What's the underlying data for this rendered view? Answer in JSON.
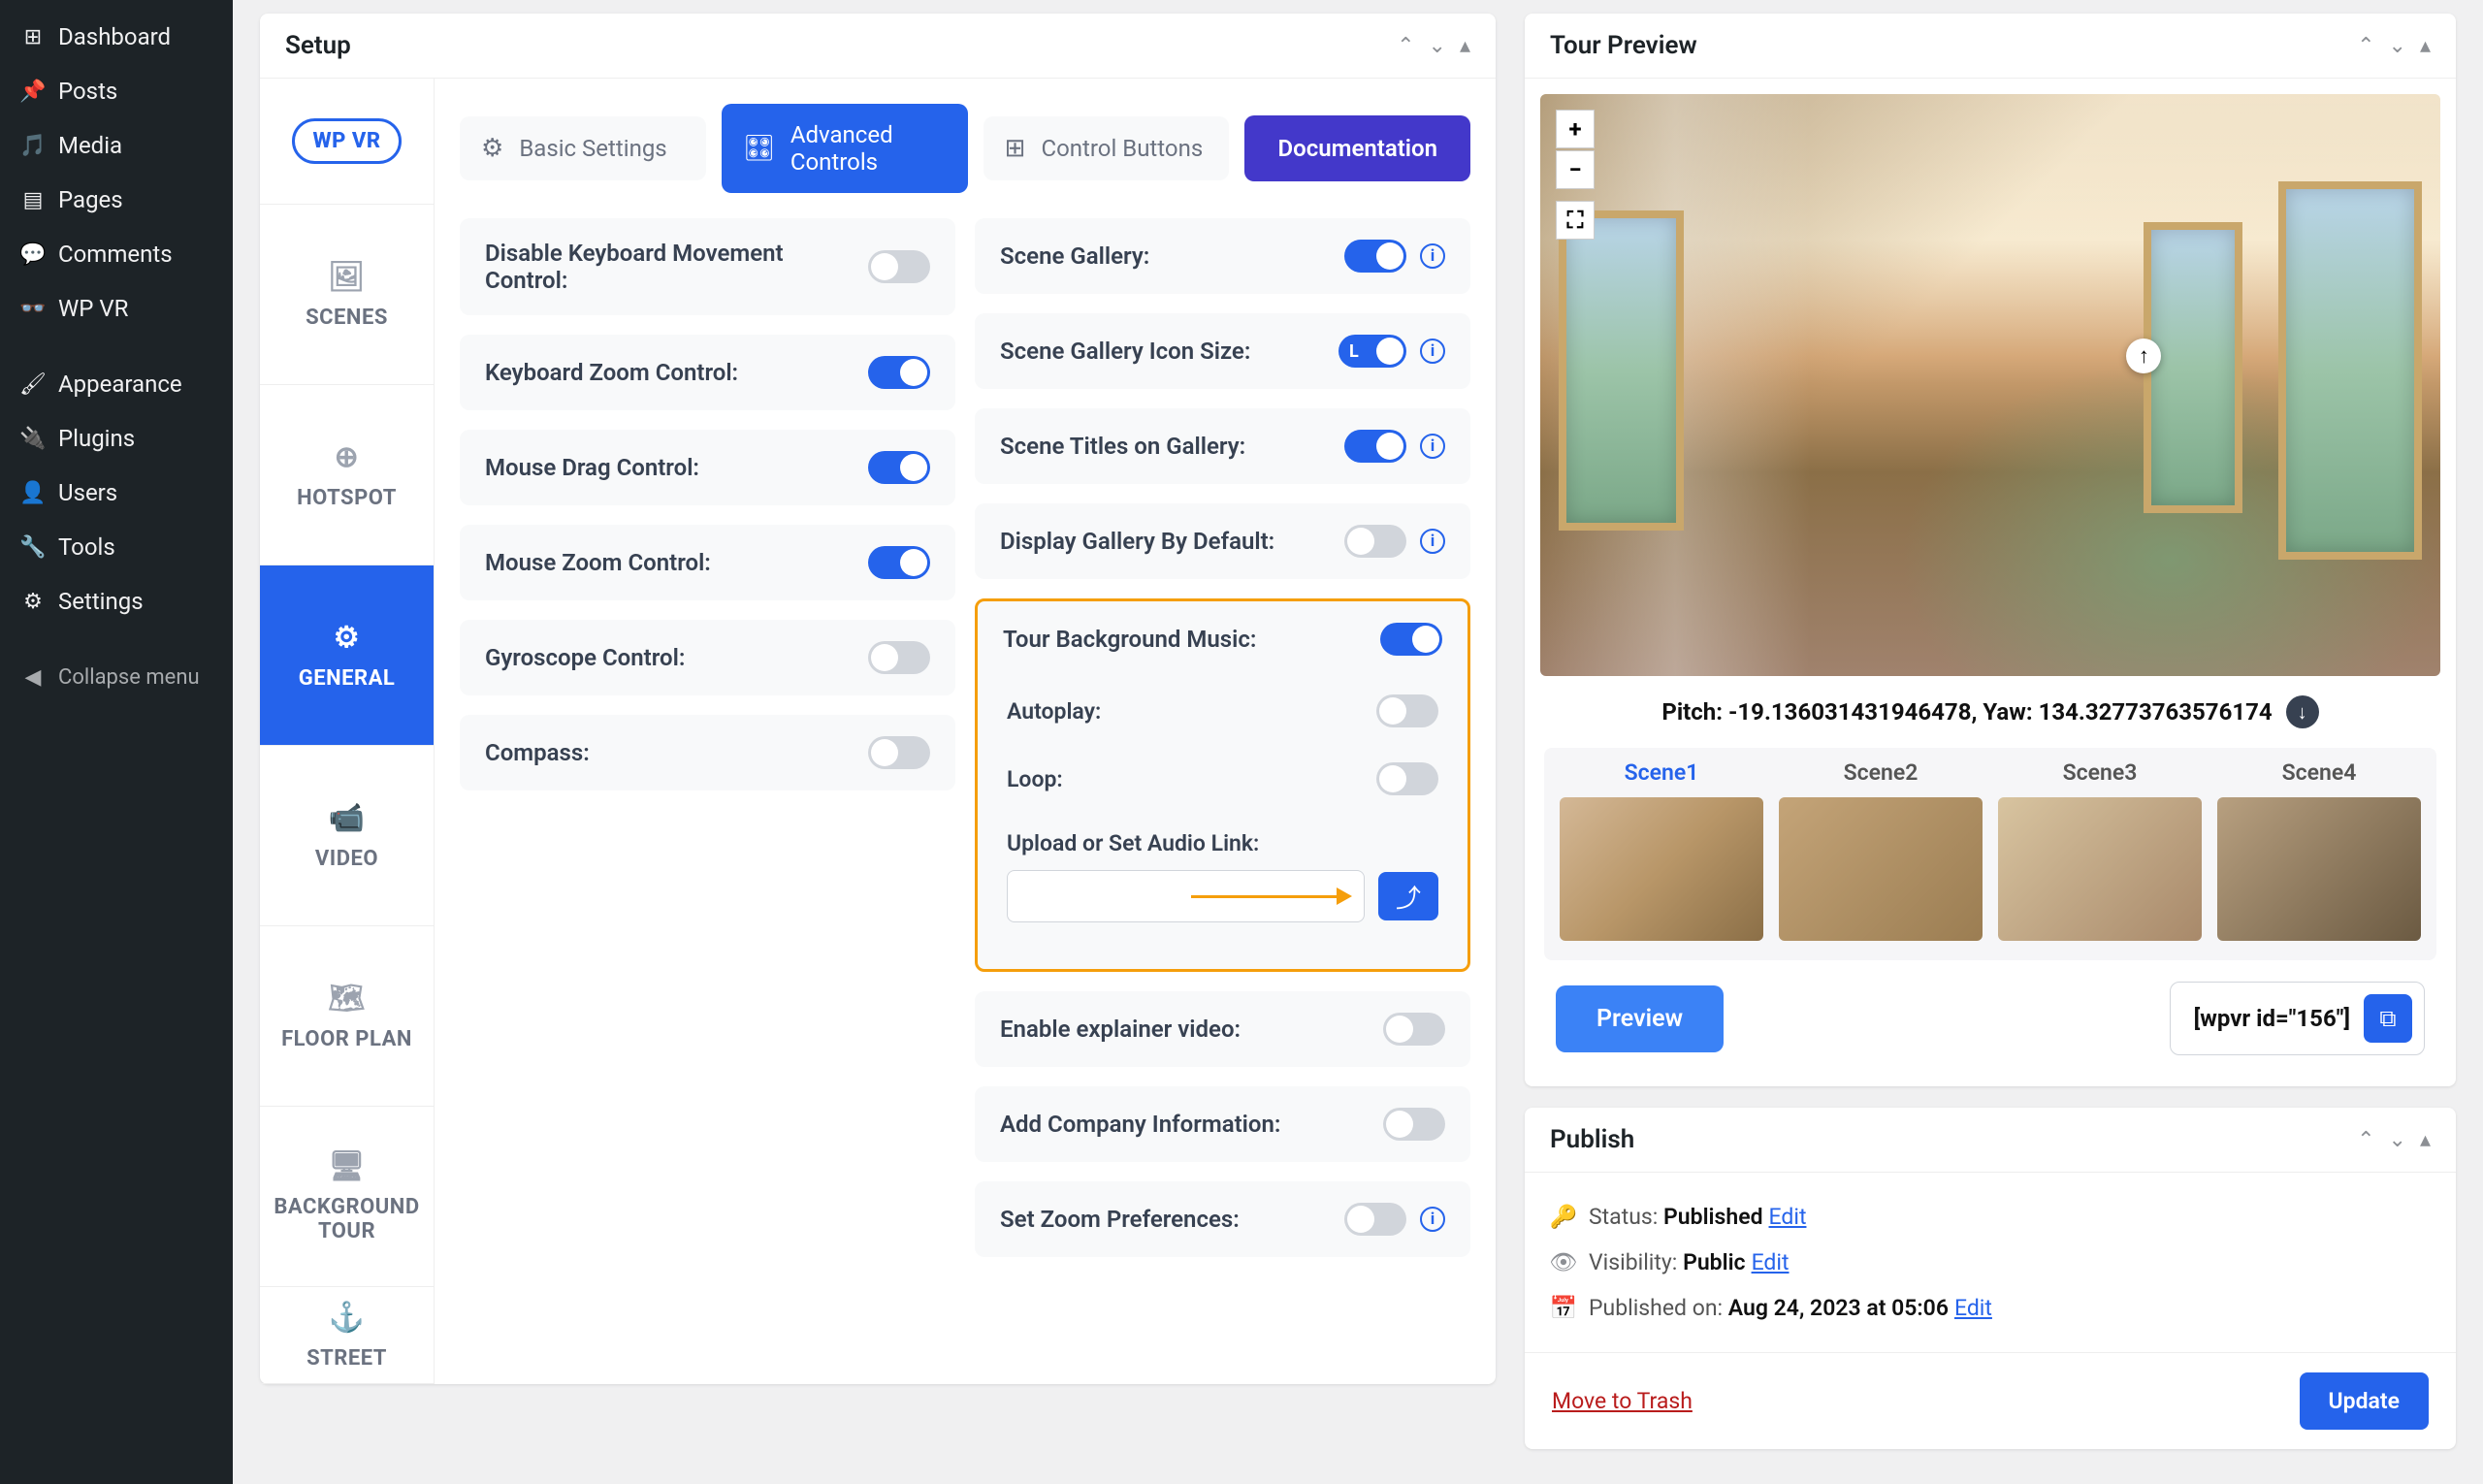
{
  "wp_menu": {
    "items": [
      {
        "icon": "dashboard",
        "label": "Dashboard"
      },
      {
        "icon": "pin",
        "label": "Posts"
      },
      {
        "icon": "media",
        "label": "Media"
      },
      {
        "icon": "page",
        "label": "Pages"
      },
      {
        "icon": "comment",
        "label": "Comments"
      },
      {
        "icon": "vr",
        "label": "WP VR"
      }
    ],
    "items2": [
      {
        "icon": "appearance",
        "label": "Appearance"
      },
      {
        "icon": "plugin",
        "label": "Plugins"
      },
      {
        "icon": "users",
        "label": "Users"
      },
      {
        "icon": "tools",
        "label": "Tools"
      },
      {
        "icon": "settings",
        "label": "Settings"
      }
    ],
    "collapse": "Collapse menu"
  },
  "setup": {
    "title": "Setup",
    "logo": "WP VR",
    "tabs": [
      "SCENES",
      "HOTSPOT",
      "GENERAL",
      "VIDEO",
      "FLOOR PLAN",
      "BACKGROUND TOUR",
      "STREET"
    ],
    "top_tabs": {
      "basic": "Basic Settings",
      "advanced": "Advanced Controls",
      "control": "Control Buttons"
    },
    "doc_btn": "Documentation",
    "left_settings": [
      {
        "label": "Disable Keyboard Movement Control:",
        "on": false
      },
      {
        "label": "Keyboard Zoom Control:",
        "on": true
      },
      {
        "label": "Mouse Drag Control:",
        "on": true
      },
      {
        "label": "Mouse Zoom Control:",
        "on": true
      },
      {
        "label": "Gyroscope Control:",
        "on": false
      },
      {
        "label": "Compass:",
        "on": false
      }
    ],
    "right_settings": [
      {
        "label": "Scene Gallery:",
        "on": true,
        "help": true
      },
      {
        "label": "Scene Gallery Icon Size:",
        "on": true,
        "help": true,
        "lg": true
      },
      {
        "label": "Scene Titles on Gallery:",
        "on": true,
        "help": true
      },
      {
        "label": "Display Gallery By Default:",
        "on": false,
        "help": true
      }
    ],
    "music": {
      "label": "Tour Background Music:",
      "autoplay": "Autoplay:",
      "loop": "Loop:",
      "upload": "Upload or Set Audio Link:"
    },
    "bottom_settings": [
      {
        "label": "Enable explainer video:",
        "on": false
      },
      {
        "label": "Add Company Information:",
        "on": false
      },
      {
        "label": "Set Zoom Preferences:",
        "on": false,
        "help": true
      }
    ]
  },
  "preview": {
    "title": "Tour Preview",
    "info": "Pitch: -19.136031431946478, Yaw: 134.32773763576174",
    "scenes": [
      "Scene1",
      "Scene2",
      "Scene3",
      "Scene4"
    ],
    "preview_btn": "Preview",
    "shortcode": "[wpvr id=\"156\"]"
  },
  "publish": {
    "title": "Publish",
    "status_label": "Status: ",
    "status_value": "Published",
    "edit": "Edit",
    "visibility_label": "Visibility: ",
    "visibility_value": "Public",
    "published_label": "Published on: ",
    "published_value": "Aug 24, 2023 at 05:06",
    "trash": "Move to Trash",
    "update": "Update"
  }
}
